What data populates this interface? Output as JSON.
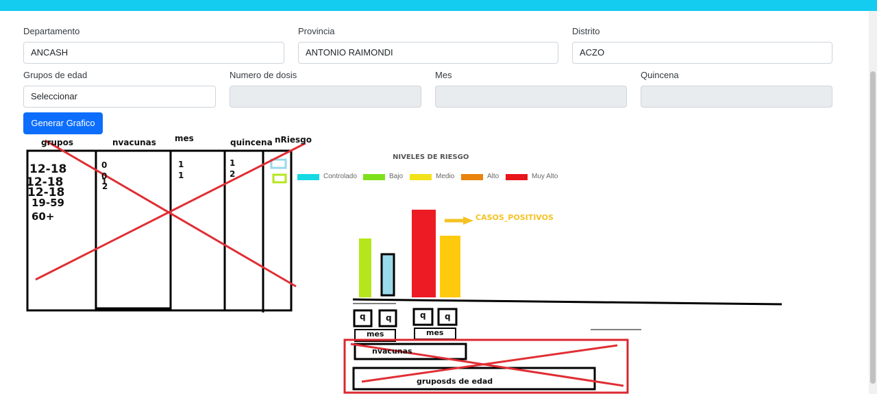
{
  "colors": {
    "topbar": "#14cbf0",
    "primary": "#0d6efd",
    "cross_red": "#e02e34",
    "box_red": "#d9272e",
    "bar_lime": "#b5e61d",
    "bar_light_blue": "#99d9ea",
    "bar_red": "#ed1c24",
    "bar_yellow": "#ffc90e",
    "arrow_yellow": "#f5c223"
  },
  "filters": {
    "departamento": {
      "label": "Departamento",
      "value": "ANCASH"
    },
    "provincia": {
      "label": "Provincia",
      "value": "ANTONIO RAIMONDI"
    },
    "distrito": {
      "label": "Distrito",
      "value": "ACZO"
    },
    "grupos_edad": {
      "label": "Grupos de edad",
      "value": "Seleccionar"
    },
    "numero_dosis": {
      "label": "Numero de dosis",
      "value": ""
    },
    "mes": {
      "label": "Mes",
      "value": ""
    },
    "quincena": {
      "label": "Quincena",
      "value": ""
    }
  },
  "button": {
    "generate_label": "Generar Grafico"
  },
  "sketch_table": {
    "headers": {
      "grupos": "grupos",
      "nvacunas": "nvacunas",
      "mes": "mes",
      "quincena": "quincena",
      "nriesgo": "nRiesgo"
    },
    "grupos": [
      "12-18",
      "12-18",
      "12-18",
      "19-59",
      "60+"
    ],
    "nvacunas": [
      "0",
      "0",
      "1",
      "2"
    ],
    "mes": [
      "1",
      "1"
    ],
    "quincena": [
      "1",
      "2"
    ]
  },
  "chart_sketch": {
    "title": "NIVELES DE RIESGO",
    "legend": [
      {
        "name": "Controlado",
        "color": "#17d9e3"
      },
      {
        "name": "Bajo",
        "color": "#7ee11c"
      },
      {
        "name": "Medio",
        "color": "#f2e21a"
      },
      {
        "name": "Alto",
        "color": "#e8830c"
      },
      {
        "name": "Muy Alto",
        "color": "#e8161b"
      }
    ],
    "annotation": "CASOS_POSITIVOS",
    "q_labels": [
      "q",
      "q",
      "q",
      "q"
    ],
    "mes_labels": [
      "mes",
      "mes"
    ],
    "nvacunas_label": "nvacunas",
    "grupos_label": "gruposds de edad"
  }
}
